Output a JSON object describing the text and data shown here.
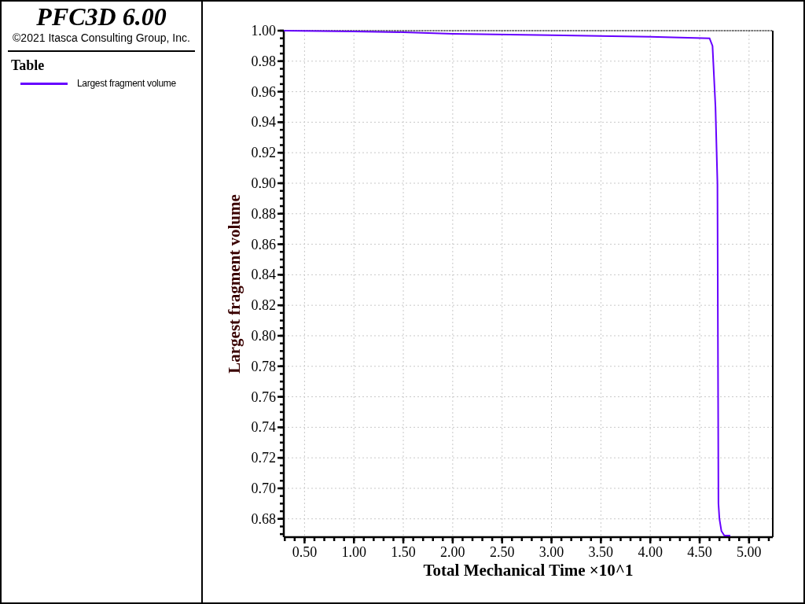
{
  "header": {
    "title": "PFC3D 6.00",
    "copyright": "©2021 Itasca Consulting Group, Inc."
  },
  "legend": {
    "title": "Table"
  },
  "plot": {
    "chart_data": {
      "type": "line",
      "grid": true,
      "xlabel": "Total Mechanical Time ×10^1",
      "ylabel": "Largest fragment volume",
      "xlim": [
        0.29,
        5.24
      ],
      "ylim": [
        0.668,
        1.0
      ],
      "xticks": [
        {
          "value": 0.5,
          "label": "0.50"
        },
        {
          "value": 1,
          "label": "1.00"
        },
        {
          "value": 1.5,
          "label": "1.50"
        },
        {
          "value": 2,
          "label": "2.00"
        },
        {
          "value": 2.5,
          "label": "2.50"
        },
        {
          "value": 3,
          "label": "3.00"
        },
        {
          "value": 3.5,
          "label": "3.50"
        },
        {
          "value": 4,
          "label": "4.00"
        },
        {
          "value": 4.5,
          "label": "4.50"
        },
        {
          "value": 5,
          "label": "5.00"
        }
      ],
      "yticks": [
        {
          "value": 0.68,
          "label": "0.68"
        },
        {
          "value": 0.7,
          "label": "0.70"
        },
        {
          "value": 0.72,
          "label": "0.72"
        },
        {
          "value": 0.74,
          "label": "0.74"
        },
        {
          "value": 0.76,
          "label": "0.76"
        },
        {
          "value": 0.78,
          "label": "0.78"
        },
        {
          "value": 0.8,
          "label": "0.80"
        },
        {
          "value": 0.82,
          "label": "0.82"
        },
        {
          "value": 0.84,
          "label": "0.84"
        },
        {
          "value": 0.86,
          "label": "0.86"
        },
        {
          "value": 0.88,
          "label": "0.88"
        },
        {
          "value": 0.9,
          "label": "0.90"
        },
        {
          "value": 0.92,
          "label": "0.92"
        },
        {
          "value": 0.94,
          "label": "0.94"
        },
        {
          "value": 0.96,
          "label": "0.96"
        },
        {
          "value": 0.98,
          "label": "0.98"
        },
        {
          "value": 1.0,
          "label": "1.00"
        }
      ],
      "x": [
        0.29,
        1.0,
        1.5,
        2.0,
        3.0,
        4.0,
        4.6,
        4.63,
        4.66,
        4.68,
        4.69,
        4.7,
        4.72,
        4.75,
        4.81
      ],
      "series": [
        {
          "name": "Largest fragment volume",
          "color": "#6600ff",
          "values": [
            1.0,
            0.9995,
            0.999,
            0.998,
            0.997,
            0.996,
            0.995,
            0.99,
            0.95,
            0.9,
            0.69,
            0.68,
            0.672,
            0.669,
            0.669
          ]
        }
      ]
    }
  }
}
